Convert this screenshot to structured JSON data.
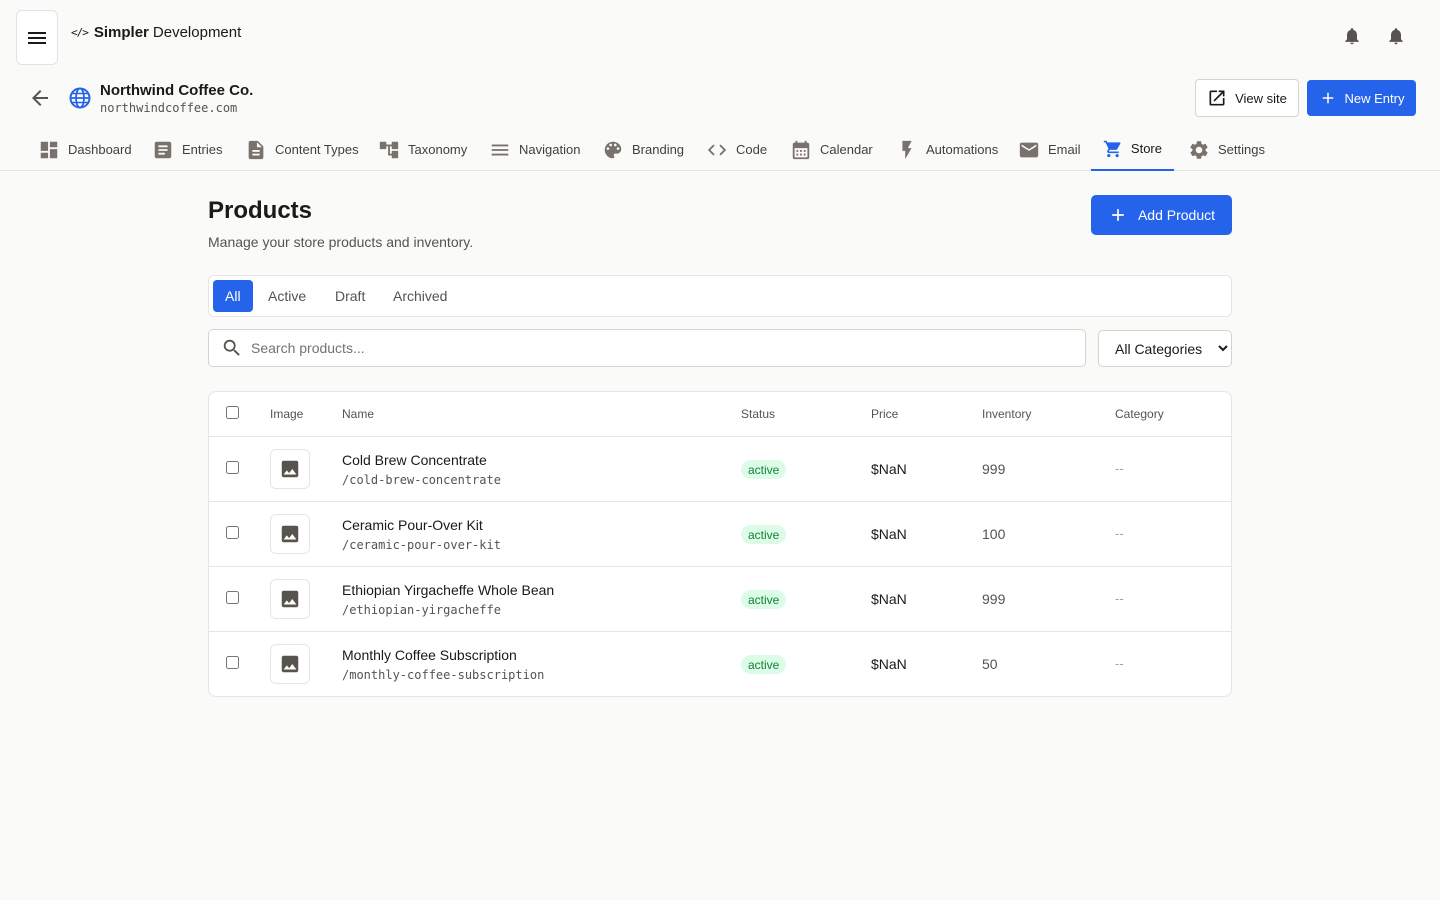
{
  "app": {
    "brand_icon": "</>",
    "brand_bold": "Simpler",
    "brand_rest": "Development"
  },
  "site": {
    "name": "Northwind Coffee Co.",
    "domain": "northwindcoffee.com"
  },
  "header": {
    "view_site": "View site",
    "new_entry": "New Entry"
  },
  "nav": {
    "tabs": [
      {
        "label": "Dashboard",
        "icon": "dashboard-icon"
      },
      {
        "label": "Entries",
        "icon": "document-icon"
      },
      {
        "label": "Content Types",
        "icon": "file-icon"
      },
      {
        "label": "Taxonomy",
        "icon": "taxonomy-icon"
      },
      {
        "label": "Navigation",
        "icon": "menu-icon"
      },
      {
        "label": "Branding",
        "icon": "palette-icon"
      },
      {
        "label": "Code",
        "icon": "code-icon"
      },
      {
        "label": "Calendar",
        "icon": "calendar-icon"
      },
      {
        "label": "Automations",
        "icon": "bolt-icon"
      },
      {
        "label": "Email",
        "icon": "mail-icon"
      },
      {
        "label": "Store",
        "icon": "cart-icon",
        "active": true
      },
      {
        "label": "Settings",
        "icon": "gear-icon"
      }
    ]
  },
  "page": {
    "title": "Products",
    "subtitle": "Manage your store products and inventory.",
    "add_button": "Add Product"
  },
  "filters": {
    "tabs": [
      "All",
      "Active",
      "Draft",
      "Archived"
    ],
    "active": "All",
    "search_placeholder": "Search products...",
    "category_selected": "All Categories"
  },
  "table": {
    "columns": [
      "Image",
      "Name",
      "Status",
      "Price",
      "Inventory",
      "Category"
    ],
    "rows": [
      {
        "name": "Cold Brew Concentrate",
        "slug": "/cold-brew-concentrate",
        "status": "active",
        "price": "$NaN",
        "inventory": "999",
        "category": "--"
      },
      {
        "name": "Ceramic Pour-Over Kit",
        "slug": "/ceramic-pour-over-kit",
        "status": "active",
        "price": "$NaN",
        "inventory": "100",
        "category": "--"
      },
      {
        "name": "Ethiopian Yirgacheffe Whole Bean",
        "slug": "/ethiopian-yirgacheffe",
        "status": "active",
        "price": "$NaN",
        "inventory": "999",
        "category": "--"
      },
      {
        "name": "Monthly Coffee Subscription",
        "slug": "/monthly-coffee-subscription",
        "status": "active",
        "price": "$NaN",
        "inventory": "50",
        "category": "--"
      }
    ]
  },
  "colors": {
    "accent": "#2563eb",
    "status_active_bg": "#dcfce7",
    "status_active_text": "#15803d"
  }
}
